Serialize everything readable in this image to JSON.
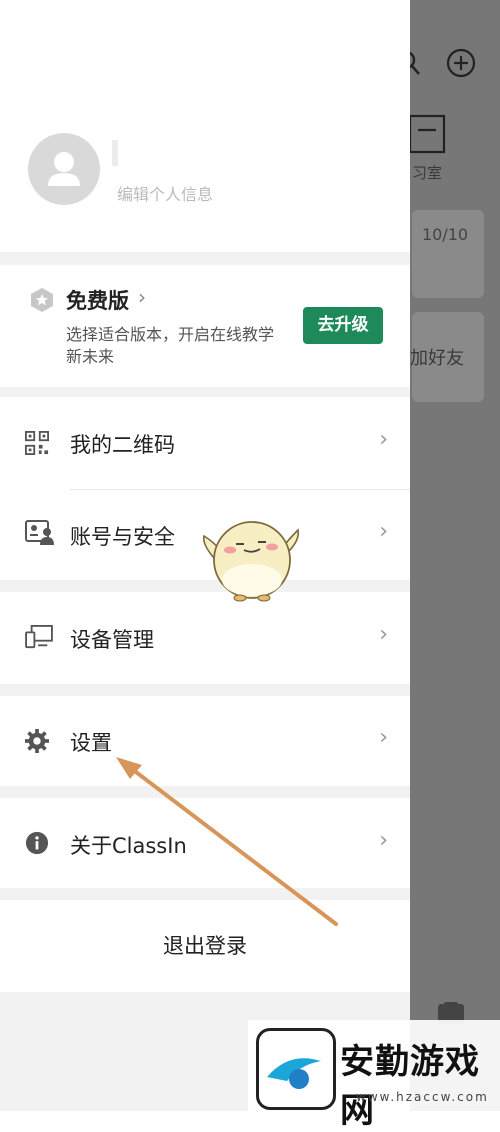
{
  "background": {
    "study_room_label": "习室",
    "progress_text": "10/10",
    "add_friend_text": "加好友"
  },
  "profile": {
    "edit_text": "编辑个人信息"
  },
  "plan": {
    "title": "免费版",
    "description": "选择适合版本，开启在线教学新未来",
    "upgrade_label": "去升级"
  },
  "menu": {
    "qr_code": "我的二维码",
    "account_security": "账号与安全",
    "device_management": "设备管理",
    "settings": "设置",
    "about": "关于ClassIn",
    "logout": "退出登录"
  },
  "watermark": {
    "brand": "安勤游戏网",
    "url": "www.hzaccw.com"
  },
  "colors": {
    "accent": "#1e8a5a",
    "arrow": "#d7955a"
  }
}
